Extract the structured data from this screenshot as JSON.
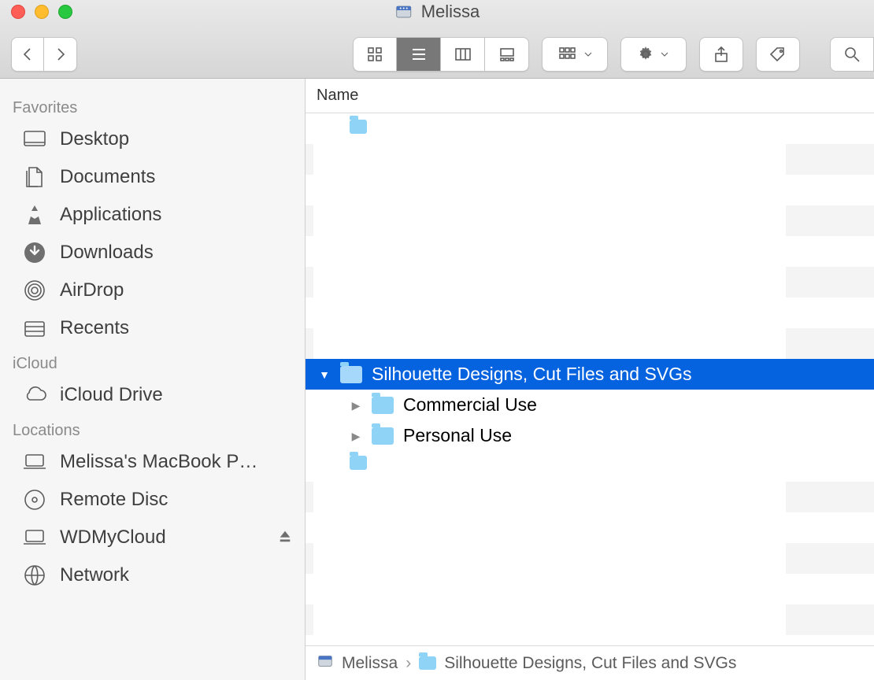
{
  "window": {
    "title": "Melissa"
  },
  "toolbar": {
    "views": [
      "icon",
      "list",
      "column",
      "gallery"
    ],
    "active_view": 1
  },
  "sidebar": {
    "sections": [
      {
        "header": "Favorites",
        "items": [
          {
            "icon": "desktop",
            "label": "Desktop"
          },
          {
            "icon": "documents",
            "label": "Documents"
          },
          {
            "icon": "applications",
            "label": "Applications"
          },
          {
            "icon": "downloads",
            "label": "Downloads"
          },
          {
            "icon": "airdrop",
            "label": "AirDrop"
          },
          {
            "icon": "recents",
            "label": "Recents"
          }
        ]
      },
      {
        "header": "iCloud",
        "items": [
          {
            "icon": "icloud",
            "label": "iCloud Drive"
          }
        ]
      },
      {
        "header": "Locations",
        "items": [
          {
            "icon": "laptop",
            "label": "Melissa's MacBook P…"
          },
          {
            "icon": "disc",
            "label": "Remote Disc"
          },
          {
            "icon": "ext",
            "label": "WDMyCloud",
            "eject": true
          },
          {
            "icon": "network",
            "label": "Network"
          }
        ]
      }
    ]
  },
  "columns": {
    "name": "Name"
  },
  "files": {
    "selected": {
      "label": "Silhouette Designs, Cut Files and SVGs"
    },
    "children": [
      {
        "label": "Commercial Use"
      },
      {
        "label": "Personal Use"
      }
    ]
  },
  "pathbar": {
    "segments": [
      "Melissa",
      "Silhouette Designs, Cut Files and SVGs"
    ]
  }
}
